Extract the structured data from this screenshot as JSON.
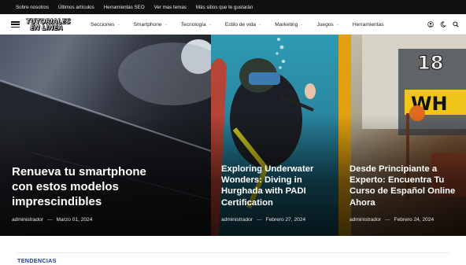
{
  "topbar": {
    "links": [
      "Sobre nosotros",
      "Últimos artículos",
      "Herramientas SEO",
      "Ver mas temas",
      "Más sitios que te gustarán"
    ]
  },
  "header": {
    "logo_line1": "TUTORIALES",
    "logo_line2": "EN LINEA",
    "nav": [
      {
        "label": "Secciones",
        "has_dropdown": true
      },
      {
        "label": "Smartphone",
        "has_dropdown": true
      },
      {
        "label": "Tecnología",
        "has_dropdown": true
      },
      {
        "label": "Estilo de vida",
        "has_dropdown": true
      },
      {
        "label": "Marketing",
        "has_dropdown": true
      },
      {
        "label": "Juegos",
        "has_dropdown": true
      },
      {
        "label": "Herramientas",
        "has_dropdown": false
      }
    ],
    "icons": [
      "user-icon",
      "dark-mode-icon",
      "search-icon"
    ]
  },
  "hero": [
    {
      "title": "Renueva tu smartphone con estos modelos imprescindibles",
      "author": "administrador",
      "date": "Marzo 01, 2024"
    },
    {
      "title": "Exploring Underwater Wonders: Diving in Hurghada with PADI Certification",
      "author": "administrador",
      "date": "Febrero 27, 2024"
    },
    {
      "title": "Desde Principiante a Experto: Encuentra Tu Curso de Español Online Ahora",
      "author": "administrador",
      "date": "Febrero 24, 2024"
    }
  ],
  "trending": {
    "label": "TENDENCIAS"
  }
}
